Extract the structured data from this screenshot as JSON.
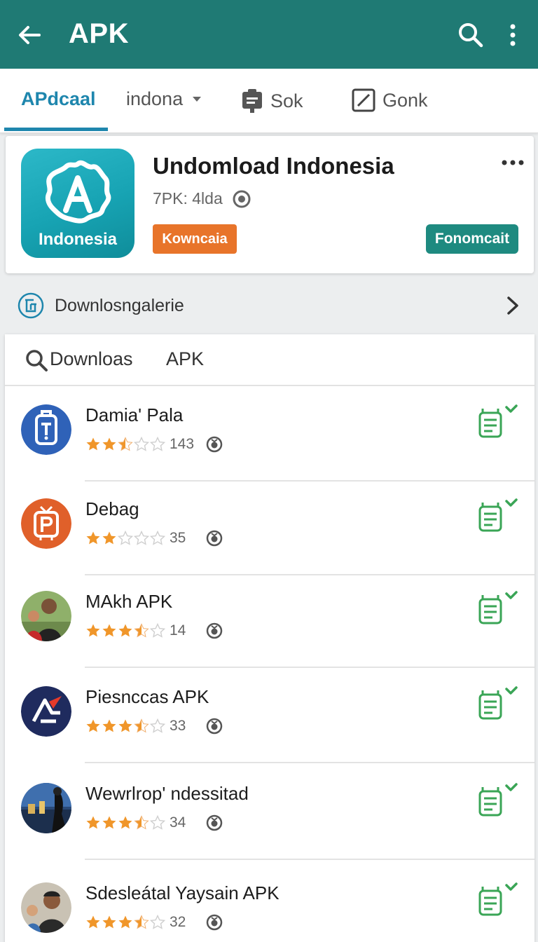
{
  "app_bar": {
    "title": "APK",
    "icons": [
      "back-arrow-icon",
      "search-icon",
      "more-vert-icon"
    ],
    "color": "#1f7a74"
  },
  "tabs": [
    {
      "label": "APdcaal",
      "active": true,
      "icon": ""
    },
    {
      "label": "indona",
      "active": false,
      "icon": "caret-down-icon"
    },
    {
      "label": "Sok",
      "active": false,
      "icon": "clipboard-icon"
    },
    {
      "label": "Gonk",
      "active": false,
      "icon": "edit-square-icon"
    }
  ],
  "tab_extra_icons": [
    "star-icon",
    "more-vert-icon"
  ],
  "accent_color": "#1e86ad",
  "header_card": {
    "icon_label": "Indonesia",
    "title": "Undomload Indonesia",
    "subtitle": "7PK: 4lda",
    "orange_button": "Kowncaia",
    "teal_button": "Fonomcait",
    "orange_color": "#e8742a",
    "teal_color": "#1e8a80"
  },
  "gallery": {
    "label": "Downlosngalerie"
  },
  "list_header": {
    "search_label": "Downloas",
    "apk_label": "APK"
  },
  "items": [
    {
      "name": "Damia' Pala",
      "rating": 2.5,
      "count": "143",
      "avatar": "blue-app-icon"
    },
    {
      "name": "Debag",
      "rating": 2,
      "count": "35",
      "avatar": "orange-tv-icon"
    },
    {
      "name": "MAkh APK",
      "rating": 3.5,
      "count": "14",
      "avatar": "people-photo"
    },
    {
      "name": "Piesnccas APK",
      "rating": 3.5,
      "count": "33",
      "avatar": "navy-logo-icon"
    },
    {
      "name": "Wewrlrop' ndessitad",
      "rating": 3.5,
      "count": "34",
      "avatar": "city-photo"
    },
    {
      "name": "Sdesleátal Yaysain APK",
      "rating": 3.5,
      "count": "32",
      "avatar": "man-photo"
    }
  ]
}
